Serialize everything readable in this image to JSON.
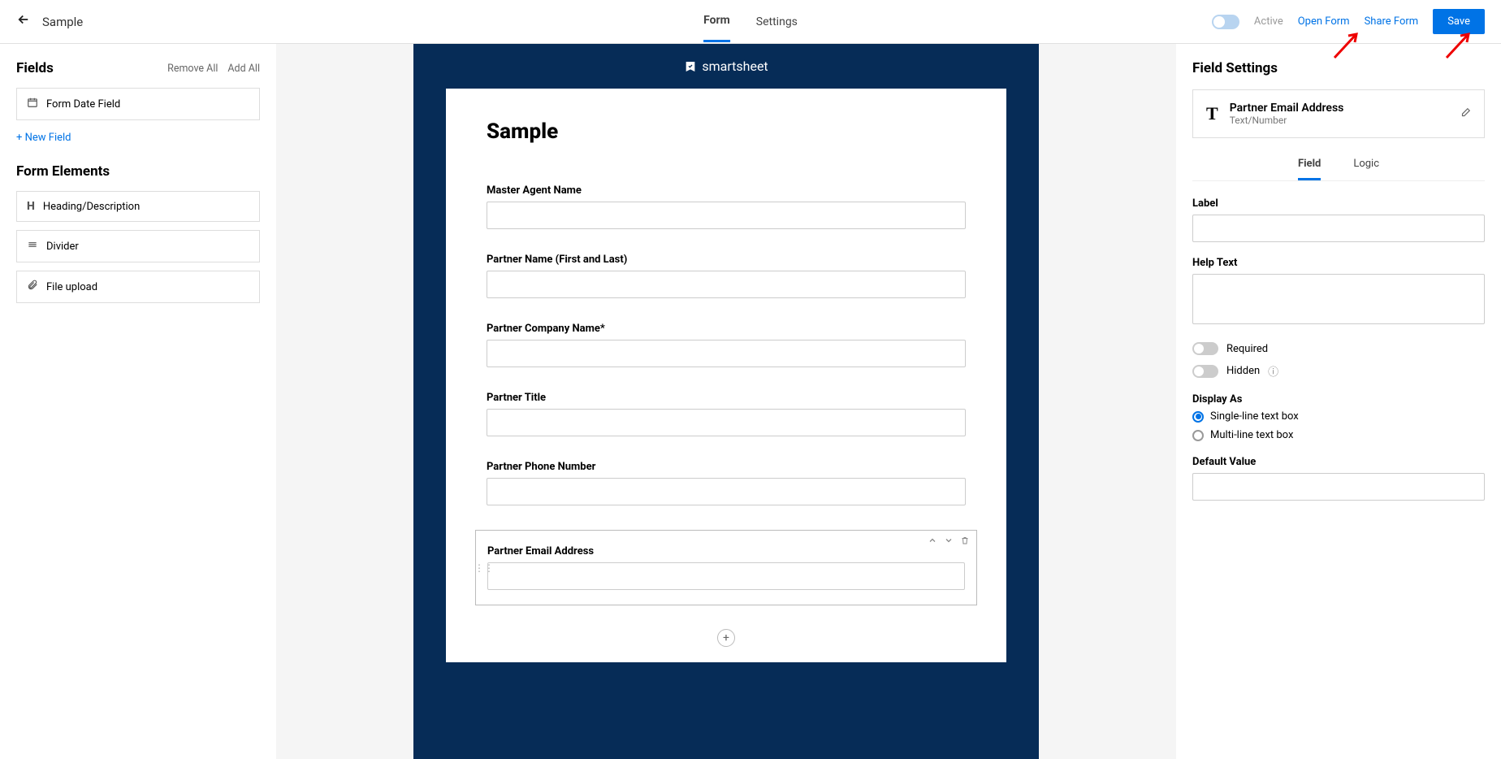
{
  "toolbar": {
    "title": "Sample",
    "tabs": {
      "form": "Form",
      "settings": "Settings"
    },
    "active_status_label": "Active",
    "open_form": "Open Form",
    "share_form": "Share Form",
    "save": "Save"
  },
  "fields_panel": {
    "header": "Fields",
    "remove_all": "Remove All",
    "add_all": "Add All",
    "items": [
      {
        "icon": "date-icon",
        "label": "Form Date Field"
      }
    ],
    "new_field": "+ New Field",
    "elements_header": "Form Elements",
    "elements": [
      {
        "icon": "H",
        "label": "Heading/Description"
      },
      {
        "icon": "divider-icon",
        "label": "Divider"
      },
      {
        "icon": "attach-icon",
        "label": "File upload"
      }
    ]
  },
  "form": {
    "brand": "smartsheet",
    "title": "Sample",
    "fields": [
      {
        "label": "Master Agent Name"
      },
      {
        "label": "Partner Name (First and Last)"
      },
      {
        "label": "Partner Company Name*"
      },
      {
        "label": "Partner Title"
      },
      {
        "label": "Partner Phone Number"
      },
      {
        "label": "Partner Email Address",
        "selected": true
      }
    ]
  },
  "settings": {
    "header": "Field Settings",
    "field_name": "Partner Email Address",
    "field_type": "Text/Number",
    "tabs": {
      "field": "Field",
      "logic": "Logic"
    },
    "label_label": "Label",
    "label_value": "",
    "help_text_label": "Help Text",
    "help_text_value": "",
    "required_label": "Required",
    "hidden_label": "Hidden",
    "display_as_label": "Display As",
    "display_single": "Single-line text box",
    "display_multi": "Multi-line text box",
    "default_value_label": "Default Value",
    "default_value": ""
  }
}
